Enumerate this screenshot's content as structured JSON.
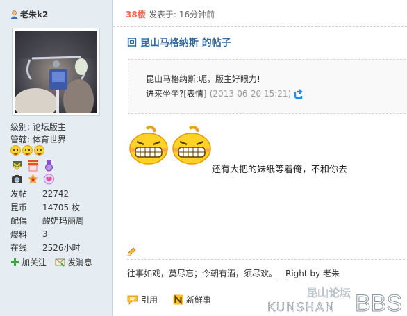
{
  "user": {
    "name": "老朱k2",
    "level": "级别: 论坛版主",
    "manage": "管辖: 体育世界",
    "stats": [
      {
        "label": "发帖",
        "value": "22742"
      },
      {
        "label": "昆币",
        "value": "14705 枚"
      },
      {
        "label": "配偶",
        "value": "酸奶玛丽周"
      },
      {
        "label": "爆料",
        "value": "3"
      },
      {
        "label": "在线",
        "value": "2526小时"
      }
    ],
    "add_follow": "加关注",
    "send_message": "发消息"
  },
  "post": {
    "floor": "38楼",
    "posted": "发表于: 16分钟前",
    "title": "回 昆山马格纳斯 的帖子",
    "quote_line1": "昆山马格纳斯:呃，版主好眼力!",
    "quote_line2": "进来坐坐?[表情]",
    "quote_date": "(2013-06-20 15:21)",
    "body": "还有大把的妹纸等着俺，不和你去",
    "signature": "往事如戏，莫尽忘；今朝有酒，须尽欢。__Right by 老朱",
    "quote_button": "引用",
    "fresh_button": "新鲜事"
  },
  "watermark": {
    "cn": "昆山论坛",
    "en": "KUNSHAN",
    "bbs": "BBS"
  },
  "colors": {
    "sidebar_bg": "#e5edf2",
    "title": "#336699",
    "floor": "#f26c4f"
  }
}
